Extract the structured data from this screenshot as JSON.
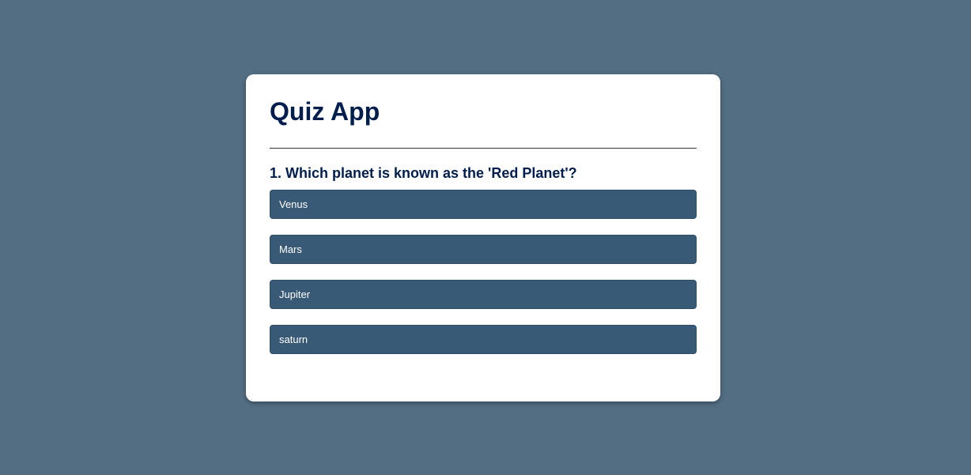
{
  "app": {
    "title": "Quiz App"
  },
  "question": {
    "text": "1. Which planet is known as the 'Red Planet'?"
  },
  "answers": [
    {
      "label": "Venus"
    },
    {
      "label": "Mars"
    },
    {
      "label": "Jupiter"
    },
    {
      "label": "saturn"
    }
  ],
  "colors": {
    "page_background": "#536d82",
    "card_background": "#ffffff",
    "title_text": "#001e4d",
    "answer_button": "#385a76",
    "answer_text": "#ffffff"
  }
}
